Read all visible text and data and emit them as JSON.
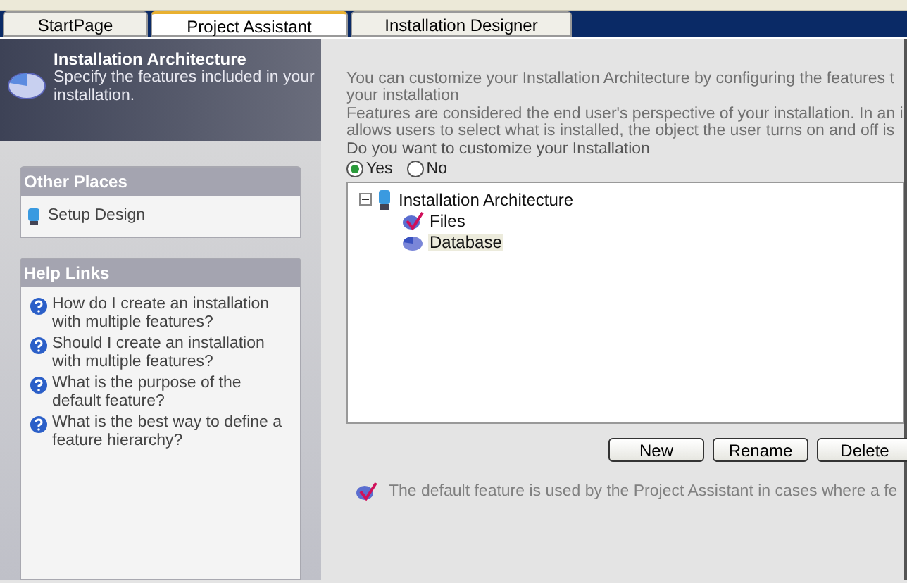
{
  "tabs": [
    {
      "label": "StartPage",
      "selected": false
    },
    {
      "label": "Project Assistant",
      "selected": true
    },
    {
      "label": "Installation Designer",
      "selected": false
    }
  ],
  "header": {
    "title": "Installation Architecture",
    "subtitle": "Specify the features included in your installation."
  },
  "other_places": {
    "title": "Other Places",
    "items": [
      "Setup Design"
    ]
  },
  "help_links": {
    "title": "Help Links",
    "items": [
      "How do I create an installation with multiple features?",
      "Should I create an installation with multiple features?",
      "What is the purpose of the default feature?",
      "What is the best way to define a feature hierarchy?"
    ]
  },
  "intro_lines": [
    "You can customize your Installation Architecture by configuring the features t",
    "your installation"
  ],
  "features_lines": [
    "Features are considered the end user's perspective of your installation. In an i",
    "allows users to select what is installed, the object the user turns on and off is"
  ],
  "question": "Do you want to customize your Installation",
  "options": [
    {
      "label": "Yes",
      "selected": true
    },
    {
      "label": "No",
      "selected": false
    }
  ],
  "tree": [
    {
      "label": "Installation Architecture",
      "expanded": true,
      "kind": "root",
      "selected": false,
      "children": [
        {
          "label": "Files",
          "kind": "default",
          "selected": false
        },
        {
          "label": "Database",
          "kind": "feature",
          "selected": true
        }
      ]
    }
  ],
  "buttons": [
    "New",
    "Rename",
    "Delete"
  ],
  "note": "The default feature is used by the Project Assistant in cases where a fe"
}
